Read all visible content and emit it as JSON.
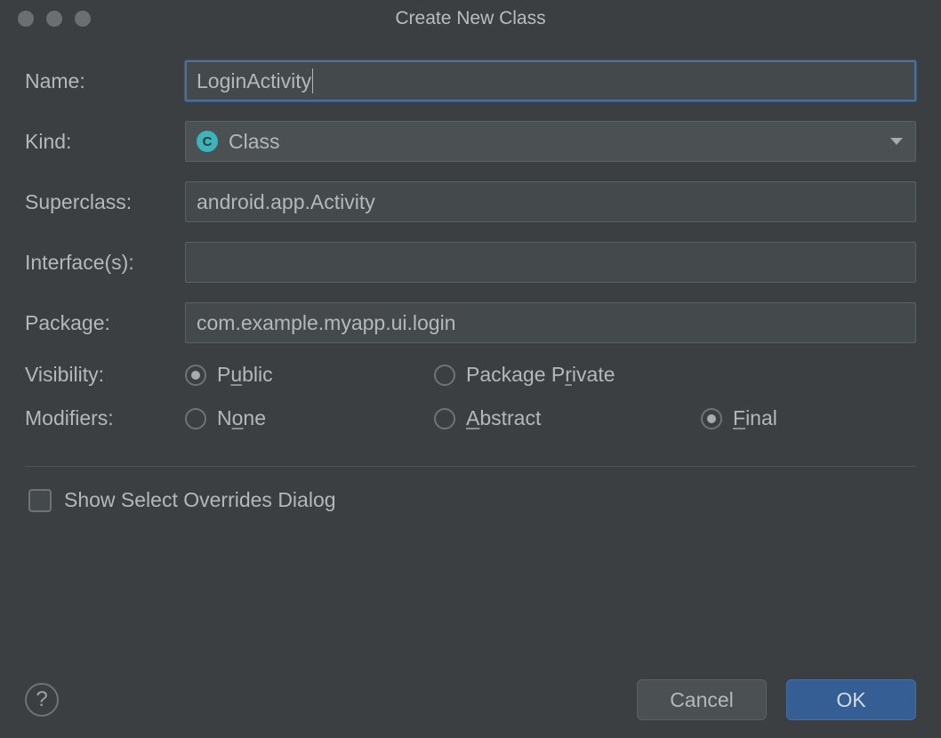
{
  "window": {
    "title": "Create New Class"
  },
  "labels": {
    "name": "Name:",
    "kind": "Kind:",
    "superclass": "Superclass:",
    "interfaces": "Interface(s):",
    "package": "Package:",
    "visibility": "Visibility:",
    "modifiers": "Modifiers:"
  },
  "fields": {
    "name_value": "LoginActivity",
    "superclass_value": "android.app.Activity",
    "interfaces_value": "",
    "package_value": "com.example.myapp.ui.login"
  },
  "kind": {
    "badge_letter": "C",
    "selected": "Class"
  },
  "visibility": {
    "public": "Public",
    "public_mn": "u",
    "package_private": "Package Private",
    "package_private_mn": "r",
    "selected": "public"
  },
  "modifiers": {
    "none": "None",
    "none_mn": "o",
    "abstract": "Abstract",
    "abstract_mn": "A",
    "final": "Final",
    "final_mn": "F",
    "selected": "final"
  },
  "checkbox": {
    "show_overrides": "Show Select Overrides Dialog",
    "checked": false
  },
  "buttons": {
    "help": "?",
    "cancel": "Cancel",
    "ok": "OK"
  }
}
